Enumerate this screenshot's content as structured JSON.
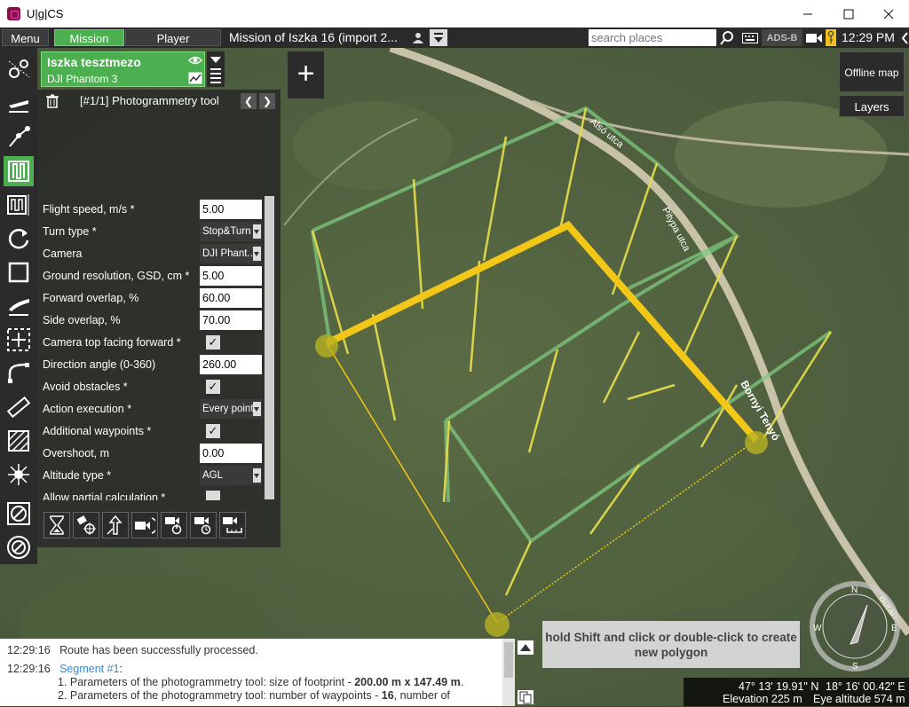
{
  "window": {
    "app_title": "U|g|CS"
  },
  "menubar": {
    "tabs": [
      "Menu",
      "Mission",
      "Player"
    ],
    "mission_title": "Mission of Iszka  16 (import 2...",
    "search_placeholder": "search places",
    "adsb_label": "ADS-B",
    "clock": "12:29 PM"
  },
  "vehicle": {
    "name": "Iszka tesztmezo",
    "type": "DJI Phantom 3"
  },
  "tool": {
    "title": "[#1/1] Photogrammetry tool",
    "params": [
      {
        "label": "Flight speed, m/s *",
        "kind": "input",
        "value": "5.00"
      },
      {
        "label": "Turn type *",
        "kind": "select",
        "value": "Stop&Turn"
      },
      {
        "label": "Camera",
        "kind": "select",
        "value": "DJI Phant..."
      },
      {
        "label": "Ground resolution, GSD, cm *",
        "kind": "input",
        "value": "5.00"
      },
      {
        "label": "Forward overlap, %",
        "kind": "input",
        "value": "60.00"
      },
      {
        "label": "Side overlap, %",
        "kind": "input",
        "value": "70.00"
      },
      {
        "label": "Camera top facing forward *",
        "kind": "check",
        "value": "✓"
      },
      {
        "label": "Direction angle (0-360)",
        "kind": "input",
        "value": "260.00"
      },
      {
        "label": "Avoid obstacles *",
        "kind": "check",
        "value": "✓"
      },
      {
        "label": "Action execution *",
        "kind": "select",
        "value": "Every point"
      },
      {
        "label": "Additional waypoints *",
        "kind": "check",
        "value": "✓"
      },
      {
        "label": "Overshoot, m",
        "kind": "input",
        "value": "0.00"
      },
      {
        "label": "Altitude type *",
        "kind": "select",
        "value": "AGL"
      },
      {
        "label": "Allow partial calculation *",
        "kind": "check",
        "value": ""
      }
    ]
  },
  "map": {
    "offline_map": "Offline map",
    "layers": "Layers",
    "road_labels": [
      "Alsó utca",
      "Pitypa utca",
      "Bornyi Tenyó",
      "Buran"
    ],
    "compass": {
      "n": "N",
      "e": "E",
      "s": "S",
      "w": "W"
    },
    "hint": "hold Shift and click or double-click to create new polygon"
  },
  "log": {
    "line1_time": "12:29:16",
    "line1_text": "Route has been successfully processed.",
    "line2_time": "12:29:16",
    "line2_segment": "Segment #1",
    "line2_colon": ":",
    "line3_pre": "1. Parameters of the photogrammetry tool: size of footprint - ",
    "line3_bold": "200.00 m x 147.49 m",
    "line3_post": ".",
    "line4_pre": "2. Parameters of the photogrammetry tool: number of waypoints - ",
    "line4_bold": "16",
    "line4_post": ", number of"
  },
  "coords": {
    "lat": "47° 13' 19.91\" N",
    "lon": "18° 16' 00.42\" E",
    "elevation": "Elevation 225 m",
    "eye_altitude": "Eye altitude 574 m"
  }
}
